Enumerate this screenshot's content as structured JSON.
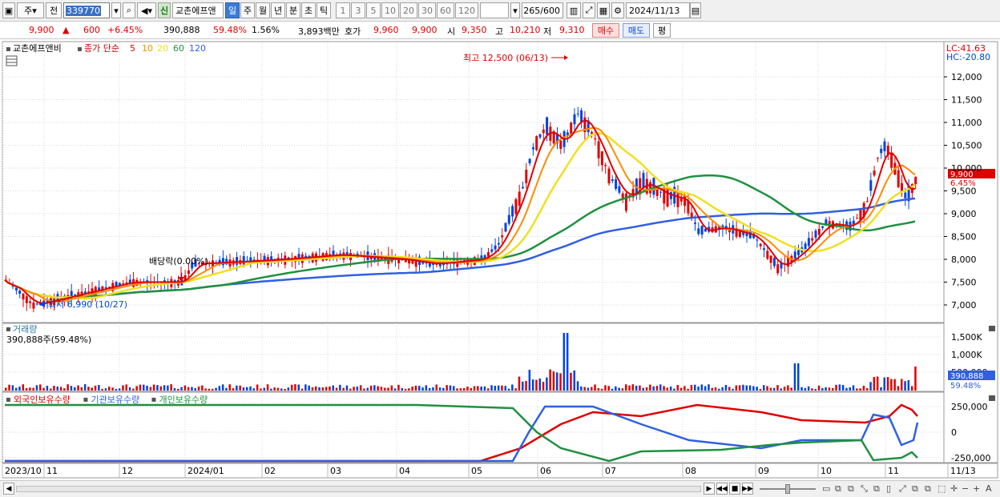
{
  "toolbar": {
    "market": "주",
    "prev_label": "전",
    "code": "339770",
    "stock_name": "교촌에프앤",
    "new_badge": "신",
    "periods": [
      {
        "label": "일",
        "selected": true
      },
      {
        "label": "주",
        "selected": false
      },
      {
        "label": "월",
        "selected": false
      },
      {
        "label": "년",
        "selected": false
      },
      {
        "label": "분",
        "selected": false
      },
      {
        "label": "초",
        "selected": false
      },
      {
        "label": "틱",
        "selected": false
      }
    ],
    "intervals": [
      "1",
      "3",
      "5",
      "10",
      "20",
      "30",
      "60",
      "120"
    ],
    "count": "265",
    "count_max": "/600",
    "date": "2024/11/13"
  },
  "quote": {
    "price": "9,900",
    "change": "600",
    "change_pct": "+6.45%",
    "volume": "390,888",
    "volume_ratio": "59.48%",
    "turnover_pct": "1.56%",
    "amount": "3,893백만",
    "hoga_label": "호가",
    "hoga1": "9,960",
    "hoga2": "9,900",
    "open_label": "시",
    "open": "9,350",
    "high_label": "고",
    "high": "10,210",
    "low_label": "저",
    "low": "9,310",
    "buy_label": "매수",
    "sell_label": "매도",
    "avg_label": "평"
  },
  "chart": {
    "price_panel": {
      "title": "교촌에프앤비",
      "ma_label": "종가 단순",
      "ma_periods": [
        "5",
        "10",
        "20",
        "60",
        "120"
      ],
      "lc": "LC:41.63",
      "hc": "HC:-20.80",
      "current_price": "9,900",
      "current_pct": "6.45%",
      "high_annotation": "최고 12,500 (06/13)",
      "low_annotation": "최저 6,990 (10/27)",
      "dividend_annotation": "배당락(0.00%)",
      "axis_labels": [
        "12,000",
        "11,500",
        "11,000",
        "10,500",
        "10,000",
        "9,500",
        "9,000",
        "8,500",
        "8,000",
        "7,500",
        "7,000"
      ]
    },
    "volume_panel": {
      "title": "거래량",
      "value_label": "390,888주(59.48%)",
      "axis_labels": [
        "1,500K",
        "1,000K",
        "500,000"
      ],
      "current_value": "390,888",
      "current_pct": "59.48%"
    },
    "holdings_panel": {
      "series": [
        {
          "name": "외국인보유수량",
          "color": "#e00000"
        },
        {
          "name": "기관보유수량",
          "color": "#3060e0"
        },
        {
          "name": "개인보유수량",
          "color": "#209040"
        }
      ],
      "axis_labels": [
        "250,000",
        "0",
        "-250,000"
      ]
    },
    "date_axis": [
      "2023/10",
      "11",
      "12",
      "2024/01",
      "02",
      "03",
      "04",
      "05",
      "06",
      "07",
      "08",
      "09",
      "10",
      "11",
      "11/13"
    ]
  },
  "colors": {
    "up": "#e00000",
    "down": "#0044dd",
    "ma5": "#e00000",
    "ma10": "#ff8c00",
    "ma20": "#f0e020",
    "ma60": "#209040",
    "ma120": "#3060e0"
  }
}
